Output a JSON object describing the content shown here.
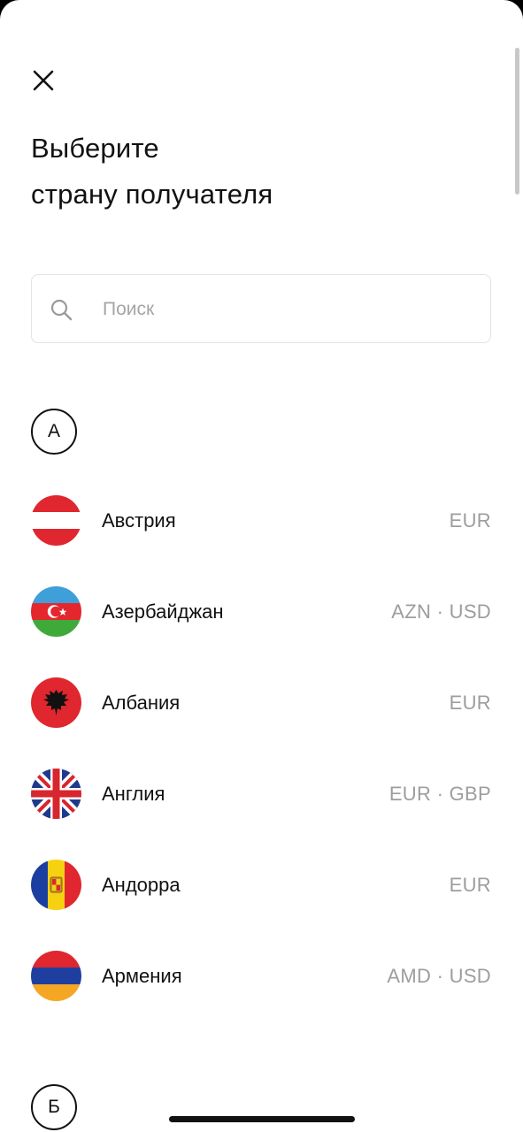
{
  "header": {
    "close_icon": "close-icon",
    "title_line1": "Выберите",
    "title_line2": "страну получателя"
  },
  "search": {
    "icon": "search-icon",
    "placeholder": "Поиск"
  },
  "sections": [
    {
      "letter": "А",
      "countries": [
        {
          "name": "Австрия",
          "currencies": "EUR",
          "flag": "austria-flag-icon"
        },
        {
          "name": "Азербайджан",
          "currencies": "AZN · USD",
          "flag": "azerbaijan-flag-icon"
        },
        {
          "name": "Албания",
          "currencies": "EUR",
          "flag": "albania-flag-icon"
        },
        {
          "name": "Англия",
          "currencies": "EUR · GBP",
          "flag": "uk-flag-icon"
        },
        {
          "name": "Андорра",
          "currencies": "EUR",
          "flag": "andorra-flag-icon"
        },
        {
          "name": "Армения",
          "currencies": "AMD · USD",
          "flag": "armenia-flag-icon"
        }
      ]
    },
    {
      "letter": "Б",
      "countries": []
    }
  ],
  "colors": {
    "text_primary": "#111111",
    "text_secondary": "#9d9d9d",
    "placeholder": "#a5a5a5",
    "border": "#e3e3e3"
  }
}
